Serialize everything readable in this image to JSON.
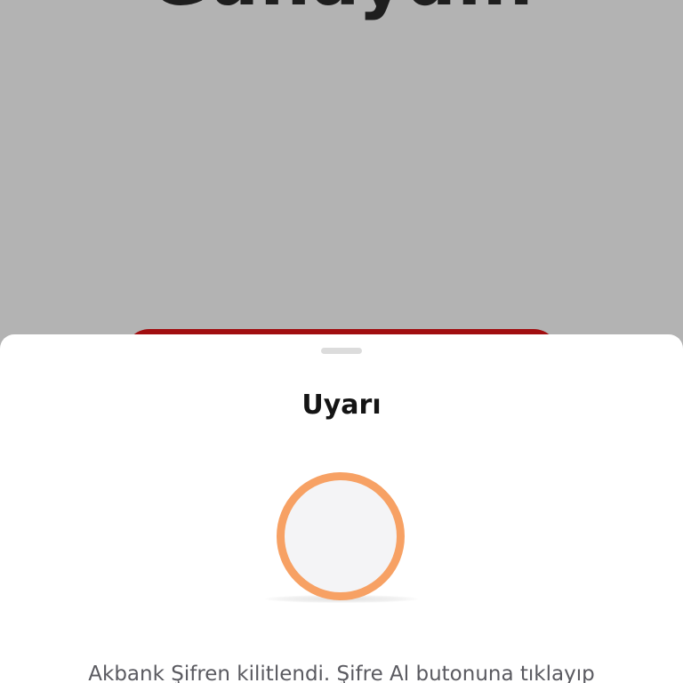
{
  "background": {
    "greeting": "Günaydın"
  },
  "sheet": {
    "title": "Uyarı",
    "message": "Akbank Şifren kilitlendi. Şifre Al butonuna tıklayıp",
    "icon": "warning-circle-icon"
  },
  "colors": {
    "backdrop": "#b3b3b3",
    "primary_red": "#a10e10",
    "icon_ring": "#f7a164"
  }
}
